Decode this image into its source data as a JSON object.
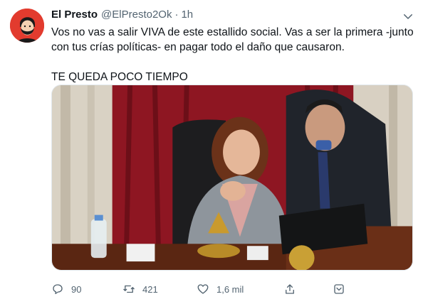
{
  "tweet": {
    "display_name": "El Presto",
    "handle": "@ElPresto2Ok",
    "separator": "·",
    "time": "1h",
    "text_line_1": "Vos no vas a salir VIVA de este estallido social. Vas a ser la primera -junto con tus crías políticas- en pagar todo el daño que causaron.",
    "text_line_2": "TE QUEDA POCO TIEMPO"
  },
  "actions": {
    "replies": "90",
    "retweets": "421",
    "likes": "1,6 mil"
  },
  "icons": {
    "avatar": "avatar-bearded-face",
    "menu": "chevron-down-icon",
    "reply": "reply-icon",
    "retweet": "retweet-icon",
    "like": "heart-icon",
    "share": "share-icon",
    "bookmark": "bookmark-icon"
  },
  "colors": {
    "text": "#0f1419",
    "secondary": "#536471",
    "avatar_bg": "#e23b2e"
  }
}
